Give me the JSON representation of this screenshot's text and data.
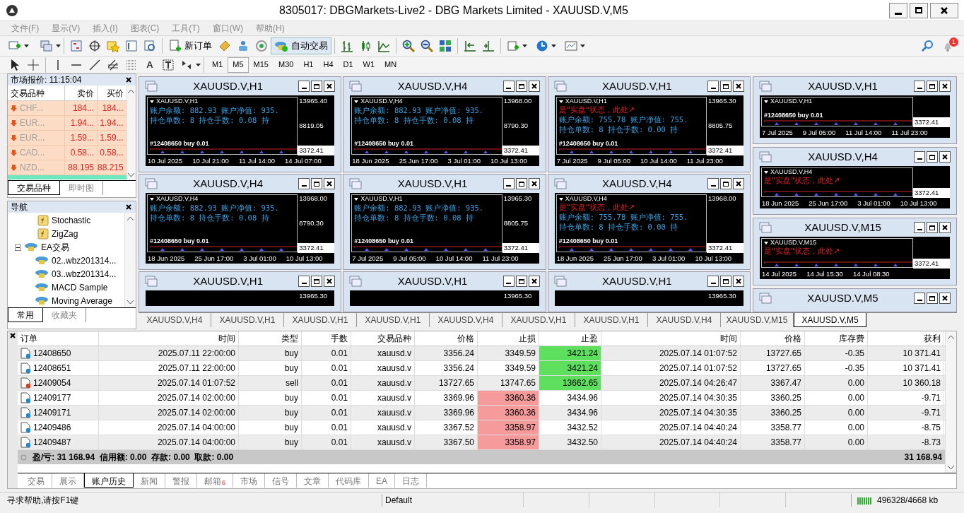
{
  "window": {
    "title": "8305017: DBGMarkets-Live2 - DBG Markets Limited - XAUUSD.V,M5"
  },
  "menu": [
    "文件(F)",
    "显示(V)",
    "插入(I)",
    "图表(C)",
    "工具(T)",
    "窗口(W)",
    "帮助(H)"
  ],
  "toolbar": {
    "buttons": [
      {
        "label": "新订单",
        "on": false
      },
      {
        "label": "自动交易",
        "on": true
      }
    ],
    "notification_badge": "1"
  },
  "drawing_tools": {
    "text_tool": "A"
  },
  "timeframes": [
    {
      "label": "M1",
      "selected": false
    },
    {
      "label": "M5",
      "selected": true
    },
    {
      "label": "M15",
      "selected": false
    },
    {
      "label": "M30",
      "selected": false
    },
    {
      "label": "H1",
      "selected": false
    },
    {
      "label": "H4",
      "selected": false
    },
    {
      "label": "D1",
      "selected": false
    },
    {
      "label": "W1",
      "selected": false
    },
    {
      "label": "MN",
      "selected": false
    }
  ],
  "market_watch": {
    "title": "市场报价: 11:15:04",
    "columns": [
      "交易品种",
      "卖价",
      "买价"
    ],
    "rows": [
      {
        "symbol": "CHF...",
        "bid": "184...",
        "ask": "184..."
      },
      {
        "symbol": "EUR...",
        "bid": "1.94...",
        "ask": "1.94..."
      },
      {
        "symbol": "EUR...",
        "bid": "1.59...",
        "ask": "1.59..."
      },
      {
        "symbol": "CAD...",
        "bid": "0.58...",
        "ask": "0.58..."
      },
      {
        "symbol": "NZD...",
        "bid": "88.195",
        "ask": "88.215"
      }
    ],
    "tabs": [
      {
        "label": "交易品种",
        "selected": true
      },
      {
        "label": "即时图",
        "selected": false
      }
    ]
  },
  "navigator": {
    "title": "导航",
    "items": [
      {
        "kind": "indicator",
        "label": "Stochastic"
      },
      {
        "kind": "indicator",
        "label": "ZigZag"
      },
      {
        "kind": "folder",
        "label": "EA交易",
        "expanded": true,
        "children": [
          {
            "kind": "expert",
            "label": "02..wbz201314..."
          },
          {
            "kind": "expert",
            "label": "03..wbz201314..."
          },
          {
            "kind": "expert",
            "label": "MACD Sample"
          },
          {
            "kind": "expert",
            "label": "Moving Average"
          }
        ]
      }
    ],
    "tabs": [
      {
        "label": "常用",
        "selected": true
      },
      {
        "label": "收藏夹",
        "selected": false
      }
    ]
  },
  "main_charts": [
    {
      "title": "XAUUSD.V,H1",
      "header": "XAUUSD.V,H1",
      "info_lines": [
        "账户余额: 882.93  账户净值: 935.",
        "持仓单数: 8  持仓手数: 0.08  持"
      ],
      "trade_label": "#12408650 buy 0.01",
      "prices": [
        "13965.40",
        "8819.05",
        "3372.41"
      ],
      "dates": [
        "10 Jul 2025",
        "10 Jul 21:00",
        "11 Jul 14:00",
        "14 Jul 07:00"
      ]
    },
    {
      "title": "XAUUSD.V,H4",
      "header": "XAUUSD.V,H4",
      "info_lines": [
        "账户余额: 882.93  账户净值: 935.",
        "持仓单数: 8  持仓手数: 0.08  持"
      ],
      "trade_label": "#12408650 buy 0.01",
      "prices": [
        "13968.00",
        "8790.30",
        "3372.41"
      ],
      "dates": [
        "18 Jun 2025",
        "25 Jun 17:00",
        "3 Jul 01:00",
        "10 Jul 13:00"
      ]
    },
    {
      "title": "XAUUSD.V,H1",
      "header": "XAUUSD.V,H1",
      "notice": "是\"实盘\"状态，此处↗",
      "info_lines": [
        "账户余额: 755.78  账户净值: 755.",
        "持仓单数: 8  持仓手数: 0.00  持"
      ],
      "trade_label": "#12408650 buy 0.01",
      "prices": [
        "13965.30",
        "8805.75",
        "3372.41"
      ],
      "dates": [
        "7 Jul 2025",
        "9 Jul 05:00",
        "10 Jul 14:00",
        "11 Jul 23:00"
      ]
    },
    {
      "title": "XAUUSD.V,H4",
      "header": "XAUUSD.V,H4",
      "info_lines": [
        "账户余额: 882.93  账户净值: 935.",
        "持仓单数: 8  持仓手数: 0.08  持"
      ],
      "trade_label": "#12408650 buy 0.01",
      "prices": [
        "13968.00",
        "8790.30",
        "3372.41"
      ],
      "dates": [
        "18 Jun 2025",
        "25 Jun 17:00",
        "3 Jul 01:00",
        "10 Jul 13:00"
      ]
    },
    {
      "title": "XAUUSD.V,H1",
      "header": "XAUUSD.V,H1",
      "info_lines": [
        "账户余额: 882.93  账户净值: 935.",
        "持仓单数: 8  持仓手数: 0.08  持"
      ],
      "trade_label": "#12408650 buy 0.01",
      "prices": [
        "13965.30",
        "8805.75",
        "3372.41"
      ],
      "dates": [
        "7 Jul 2025",
        "9 Jul 05:00",
        "10 Jul 14:00",
        "11 Jul 23:00"
      ]
    },
    {
      "title": "XAUUSD.V,H4",
      "header": "XAUUSD.V,H4",
      "notice": "是\"实盘\"状态，此处↗",
      "info_lines": [
        "账户余额: 755.78  账户净值: 755.",
        "持仓单数: 8  持仓手数: 0.00  持"
      ],
      "trade_label": "#12408650 buy 0.01",
      "prices": [
        "13968.00",
        "3372.41"
      ],
      "dates": [
        "18 Jun 2025",
        "25 Jun 17:00",
        "3 Jul 01:00",
        "10 Jul 13:00"
      ]
    },
    {
      "title": "XAUUSD.V,H1",
      "prices": [
        "13965.30"
      ]
    },
    {
      "title": "XAUUSD.V,H1",
      "prices": [
        "13965.30"
      ]
    },
    {
      "title": "XAUUSD.V,H1",
      "prices": [
        "13965.30"
      ]
    }
  ],
  "side_charts": [
    {
      "title": "XAUUSD.V,H1",
      "header": "XAUUSD.V,H1",
      "trade_label": "#12408650 buy 0.01",
      "prices": [
        "3372.41"
      ],
      "dates": [
        "7 Jul 2025",
        "9 Jul 05:00",
        "11 Jul 14:00",
        "11 Jul 23:00"
      ]
    },
    {
      "title": "XAUUSD.V,H4",
      "header": "XAUUSD.V,H4",
      "notice": "是\"实盘\"状态，此处↗",
      "prices": [
        "3372.41"
      ],
      "dates": [
        "18 Jun 2025",
        "25 Jun 17:00",
        "3 Jul 01:00",
        "10 Jul 13:00"
      ]
    },
    {
      "title": "XAUUSD.V,M15",
      "header": "XAUUSD.V,M15",
      "notice": "是\"实盘\"状态，此处↗",
      "prices": [
        "3372.41"
      ],
      "dates": [
        "14 Jul 2025",
        "14 Jul 15:30",
        "14 Jul 08:30"
      ]
    },
    {
      "title": "XAUUSD.V,M5"
    }
  ],
  "chart_tabs": [
    {
      "label": "XAUUSD.V,H4",
      "selected": false
    },
    {
      "label": "XAUUSD.V,H1",
      "selected": false
    },
    {
      "label": "XAUUSD.V,H1",
      "selected": false
    },
    {
      "label": "XAUUSD.V,H1",
      "selected": false
    },
    {
      "label": "XAUUSD.V,H4",
      "selected": false
    },
    {
      "label": "XAUUSD.V,H1",
      "selected": false
    },
    {
      "label": "XAUUSD.V,H1",
      "selected": false
    },
    {
      "label": "XAUUSD.V,H4",
      "selected": false
    },
    {
      "label": "XAUUSD.V,M15",
      "selected": false
    },
    {
      "label": "XAUUSD.V,M5",
      "selected": true
    }
  ],
  "terminal": {
    "columns": [
      "订单",
      "时间",
      "类型",
      "手数",
      "交易品种",
      "价格",
      "止损",
      "止盈",
      "时间",
      "价格",
      "库存费",
      "获利"
    ],
    "rows": [
      {
        "kind": "buy",
        "stop_loss_hit": false,
        "take_profit_hit": true,
        "cells": [
          "12408650",
          "2025.07.11 22:00:00",
          "buy",
          "0.01",
          "xauusd.v",
          "3356.24",
          "3349.59",
          "3421.24",
          "2025.07.14 01:07:52",
          "13727.65",
          "-0.35",
          "10 371.41"
        ]
      },
      {
        "kind": "buy",
        "stop_loss_hit": false,
        "take_profit_hit": true,
        "cells": [
          "12408651",
          "2025.07.11 22:00:00",
          "buy",
          "0.01",
          "xauusd.v",
          "3356.24",
          "3349.59",
          "3421.24",
          "2025.07.14 01:07:52",
          "13727.65",
          "-0.35",
          "10 371.41"
        ]
      },
      {
        "kind": "sell",
        "stop_loss_hit": false,
        "take_profit_hit": true,
        "cells": [
          "12409054",
          "2025.07.14 01:07:52",
          "sell",
          "0.01",
          "xauusd.v",
          "13727.65",
          "13747.65",
          "13662.65",
          "2025.07.14 04:26:47",
          "3367.47",
          "0.00",
          "10 360.18"
        ]
      },
      {
        "kind": "buy",
        "stop_loss_hit": true,
        "take_profit_hit": false,
        "cells": [
          "12409177",
          "2025.07.14 02:00:00",
          "buy",
          "0.01",
          "xauusd.v",
          "3369.96",
          "3360.36",
          "3434.96",
          "2025.07.14 04:30:35",
          "3360.25",
          "0.00",
          "-9.71"
        ]
      },
      {
        "kind": "buy",
        "stop_loss_hit": true,
        "take_profit_hit": false,
        "cells": [
          "12409171",
          "2025.07.14 02:00:00",
          "buy",
          "0.01",
          "xauusd.v",
          "3369.96",
          "3360.36",
          "3434.96",
          "2025.07.14 04:30:35",
          "3360.25",
          "0.00",
          "-9.71"
        ]
      },
      {
        "kind": "buy",
        "stop_loss_hit": true,
        "take_profit_hit": false,
        "cells": [
          "12409486",
          "2025.07.14 04:00:00",
          "buy",
          "0.01",
          "xauusd.v",
          "3367.52",
          "3358.97",
          "3432.52",
          "2025.07.14 04:40:24",
          "3358.77",
          "0.00",
          "-8.75"
        ]
      },
      {
        "kind": "buy",
        "stop_loss_hit": true,
        "take_profit_hit": false,
        "cells": [
          "12409487",
          "2025.07.14 04:00:00",
          "buy",
          "0.01",
          "xauusd.v",
          "3367.50",
          "3358.97",
          "3432.50",
          "2025.07.14 04:40:24",
          "3358.77",
          "0.00",
          "-8.73"
        ]
      }
    ],
    "summary": "盈/亏: 31 168.94  信用额: 0.00  存款: 0.00  取款: 0.00",
    "total": "31 168.94",
    "tabs": [
      {
        "label": "交易",
        "selected": false
      },
      {
        "label": "展示",
        "selected": false
      },
      {
        "label": "账户历史",
        "selected": true
      },
      {
        "label": "新闻",
        "selected": false
      },
      {
        "label": "警报",
        "selected": false
      },
      {
        "label": "邮箱",
        "selected": false,
        "badge": "6"
      },
      {
        "label": "市场",
        "selected": false
      },
      {
        "label": "信号",
        "selected": false
      },
      {
        "label": "文章",
        "selected": false
      },
      {
        "label": "代码库",
        "selected": false
      },
      {
        "label": "EA",
        "selected": false
      },
      {
        "label": "日志",
        "selected": false
      }
    ]
  },
  "status_bar": {
    "help": "寻求帮助,请按F1键",
    "profile": "Default",
    "traffic": "496328/4668 kb"
  }
}
